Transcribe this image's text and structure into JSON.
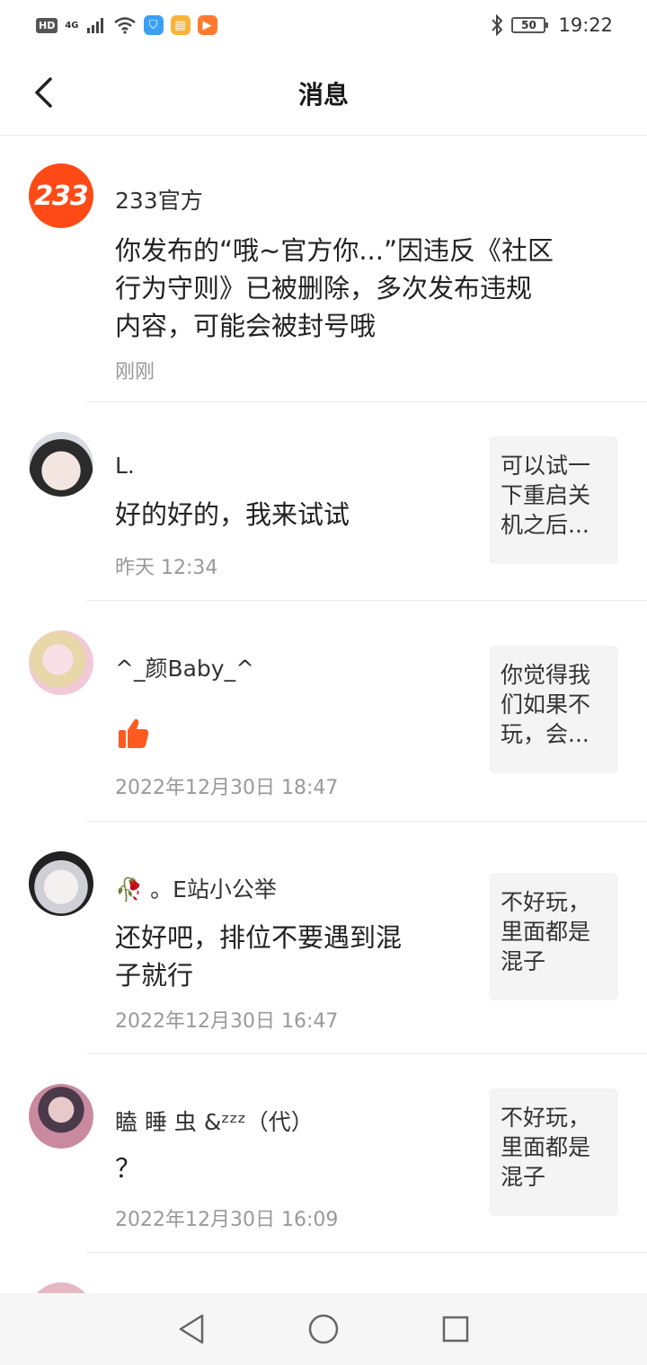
{
  "status_bar": {
    "hd": "HD",
    "network": "4G",
    "battery": "50",
    "time": "19:22"
  },
  "header": {
    "title": "消息"
  },
  "messages": [
    {
      "avatar_text": "233",
      "name": "233官方",
      "content_lines": [
        "你发布的“哦~官方你...”因违反《社区",
        "行为守则》已被删除，多次发布违规",
        "内容，可能会被封号哦"
      ],
      "time": "刚刚"
    },
    {
      "name": "L.",
      "content": "好的好的，我来试试",
      "time": "昨天 12:34",
      "quote_lines": [
        "可以试一",
        "下重启关",
        "机之后..."
      ]
    },
    {
      "name": "^_颜Baby_^",
      "content": "",
      "time": "2022年12月30日 18:47",
      "quote_lines": [
        "你觉得我",
        "们如果不",
        "玩，会..."
      ]
    },
    {
      "name_emoji": "🥀",
      "name": "。E站小公举",
      "content_lines": [
        "还好吧，排位不要遇到混",
        "子就行"
      ],
      "time": "2022年12月30日 16:47",
      "quote_lines": [
        "不好玩，",
        "里面都是",
        "混子"
      ]
    },
    {
      "name": "瞌 睡 虫 &ᶻᶻᶻ（代）",
      "content": "？",
      "time": "2022年12月30日 16:09",
      "quote_lines": [
        "不好玩，",
        "里面都是",
        "混子"
      ]
    }
  ],
  "colors": {
    "brand_orange": "#ff4a17",
    "like_orange": "#ff5a1f",
    "secondary_text": "#999999"
  }
}
